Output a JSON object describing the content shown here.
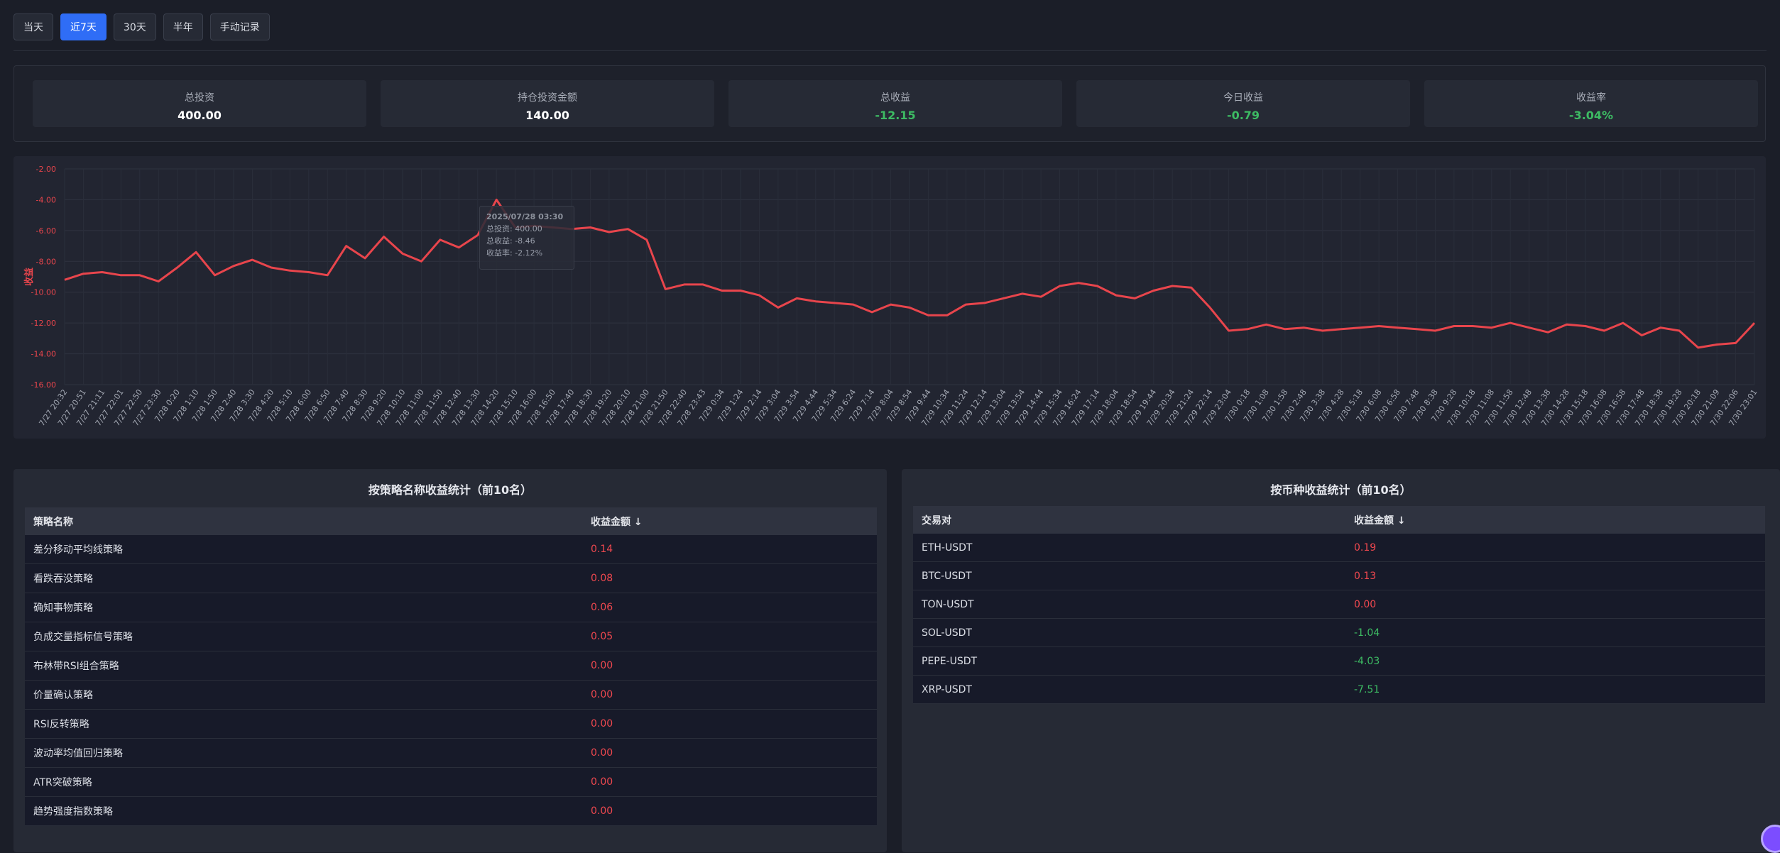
{
  "toolbar": {
    "buttons": [
      {
        "label": "当天",
        "active": false
      },
      {
        "label": "近7天",
        "active": true
      },
      {
        "label": "30天",
        "active": false
      },
      {
        "label": "半年",
        "active": false
      },
      {
        "label": "手动记录",
        "active": false
      }
    ]
  },
  "stats": [
    {
      "label": "总投资",
      "value": "400.00",
      "negative": false
    },
    {
      "label": "持仓投资金额",
      "value": "140.00",
      "negative": false
    },
    {
      "label": "总收益",
      "value": "-12.15",
      "negative": true
    },
    {
      "label": "今日收益",
      "value": "-0.79",
      "negative": true
    },
    {
      "label": "收益率",
      "value": "-3.04%",
      "negative": true
    }
  ],
  "tooltip": {
    "title": "2025/07/28 03:30",
    "line1": "总投资: 400.00",
    "line2": "总收益: -8.46",
    "line3": "收益率: -2.12%"
  },
  "chart_data": {
    "type": "line",
    "ylabel": "收益",
    "ylim": [
      -16,
      -2
    ],
    "yticks": [
      "-2.00",
      "-4.00",
      "-6.00",
      "-8.00",
      "-10.00",
      "-12.00",
      "-14.00",
      "-16.00"
    ],
    "xticks": [
      "7/27 20:32",
      "7/27 20:51",
      "7/27 21:11",
      "7/27 22:01",
      "7/27 22:50",
      "7/27 23:30",
      "7/28 0:20",
      "7/28 1:10",
      "7/28 1:50",
      "7/28 2:40",
      "7/28 3:30",
      "7/28 4:20",
      "7/28 5:10",
      "7/28 6:00",
      "7/28 6:50",
      "7/28 7:40",
      "7/28 8:30",
      "7/28 9:20",
      "7/28 10:10",
      "7/28 11:00",
      "7/28 11:50",
      "7/28 12:40",
      "7/28 13:30",
      "7/28 14:20",
      "7/28 15:10",
      "7/28 16:00",
      "7/28 16:50",
      "7/28 17:40",
      "7/28 18:30",
      "7/28 19:20",
      "7/28 20:10",
      "7/28 21:00",
      "7/28 21:50",
      "7/28 22:40",
      "7/28 23:43",
      "7/29 0:34",
      "7/29 1:24",
      "7/29 2:14",
      "7/29 3:04",
      "7/29 3:54",
      "7/29 4:44",
      "7/29 5:34",
      "7/29 6:24",
      "7/29 7:14",
      "7/29 8:04",
      "7/29 8:54",
      "7/29 9:44",
      "7/29 10:34",
      "7/29 11:24",
      "7/29 12:14",
      "7/29 13:04",
      "7/29 13:54",
      "7/29 14:44",
      "7/29 15:34",
      "7/29 16:24",
      "7/29 17:14",
      "7/29 18:04",
      "7/29 18:54",
      "7/29 19:44",
      "7/29 20:34",
      "7/29 21:24",
      "7/29 22:14",
      "7/29 23:04",
      "7/30 0:18",
      "7/30 1:08",
      "7/30 1:58",
      "7/30 2:48",
      "7/30 3:38",
      "7/30 4:28",
      "7/30 5:18",
      "7/30 6:08",
      "7/30 6:58",
      "7/30 7:48",
      "7/30 8:38",
      "7/30 9:28",
      "7/30 10:18",
      "7/30 11:08",
      "7/30 11:58",
      "7/30 12:48",
      "7/30 13:38",
      "7/30 14:28",
      "7/30 15:18",
      "7/30 16:08",
      "7/30 16:58",
      "7/30 17:48",
      "7/30 18:38",
      "7/30 19:28",
      "7/30 20:18",
      "7/30 21:09",
      "7/30 22:06",
      "7/30 23:01"
    ],
    "series": [
      {
        "color": "#e8454c",
        "values": [
          -9.2,
          -8.8,
          -8.7,
          -8.9,
          -8.9,
          -9.3,
          -8.4,
          -7.4,
          -8.9,
          -8.3,
          -7.9,
          -8.4,
          -8.6,
          -8.7,
          -8.9,
          -7.0,
          -7.8,
          -6.4,
          -7.5,
          -8.0,
          -6.6,
          -7.1,
          -6.3,
          -4.0,
          -5.8,
          -5.7,
          -5.8,
          -5.9,
          -5.8,
          -6.1,
          -5.9,
          -6.6,
          -9.8,
          -9.5,
          -9.5,
          -9.9,
          -9.9,
          -10.2,
          -11.0,
          -10.4,
          -10.6,
          -10.7,
          -10.8,
          -11.3,
          -10.8,
          -11.0,
          -11.5,
          -11.5,
          -10.8,
          -10.7,
          -10.4,
          -10.1,
          -10.3,
          -9.6,
          -9.4,
          -9.6,
          -10.2,
          -10.4,
          -9.9,
          -9.6,
          -9.7,
          -11.0,
          -12.5,
          -12.4,
          -12.1,
          -12.4,
          -12.3,
          -12.5,
          -12.4,
          -12.3,
          -12.2,
          -12.3,
          -12.4,
          -12.5,
          -12.2,
          -12.2,
          -12.3,
          -12.0,
          -12.3,
          -12.6,
          -12.1,
          -12.2,
          -12.5,
          -12.0,
          -12.8,
          -12.3,
          -12.5,
          -13.6,
          -13.4,
          -13.3,
          -12.0
        ]
      }
    ]
  },
  "strategy_panel": {
    "title": "按策略名称收益统计（前10名）",
    "col_name": "策略名称",
    "col_value": "收益金额 ↓",
    "rows": [
      {
        "name": "差分移动平均线策略",
        "value": "0.14"
      },
      {
        "name": "看跌吞没策略",
        "value": "0.08"
      },
      {
        "name": "确知事物策略",
        "value": "0.06"
      },
      {
        "name": "负成交量指标信号策略",
        "value": "0.05"
      },
      {
        "name": "布林带RSI组合策略",
        "value": "0.00"
      },
      {
        "name": "价量确认策略",
        "value": "0.00"
      },
      {
        "name": "RSI反转策略",
        "value": "0.00"
      },
      {
        "name": "波动率均值回归策略",
        "value": "0.00"
      },
      {
        "name": "ATR突破策略",
        "value": "0.00"
      },
      {
        "name": "趋势强度指数策略",
        "value": "0.00"
      }
    ]
  },
  "pair_panel": {
    "title": "按币种收益统计（前10名）",
    "col_name": "交易对",
    "col_value": "收益金额 ↓",
    "rows": [
      {
        "name": "ETH-USDT",
        "value": "0.19",
        "negative": false
      },
      {
        "name": "BTC-USDT",
        "value": "0.13",
        "negative": false
      },
      {
        "name": "TON-USDT",
        "value": "0.00",
        "negative": false
      },
      {
        "name": "SOL-USDT",
        "value": "-1.04",
        "negative": true
      },
      {
        "name": "PEPE-USDT",
        "value": "-4.03",
        "negative": true
      },
      {
        "name": "XRP-USDT",
        "value": "-7.51",
        "negative": true
      }
    ]
  }
}
